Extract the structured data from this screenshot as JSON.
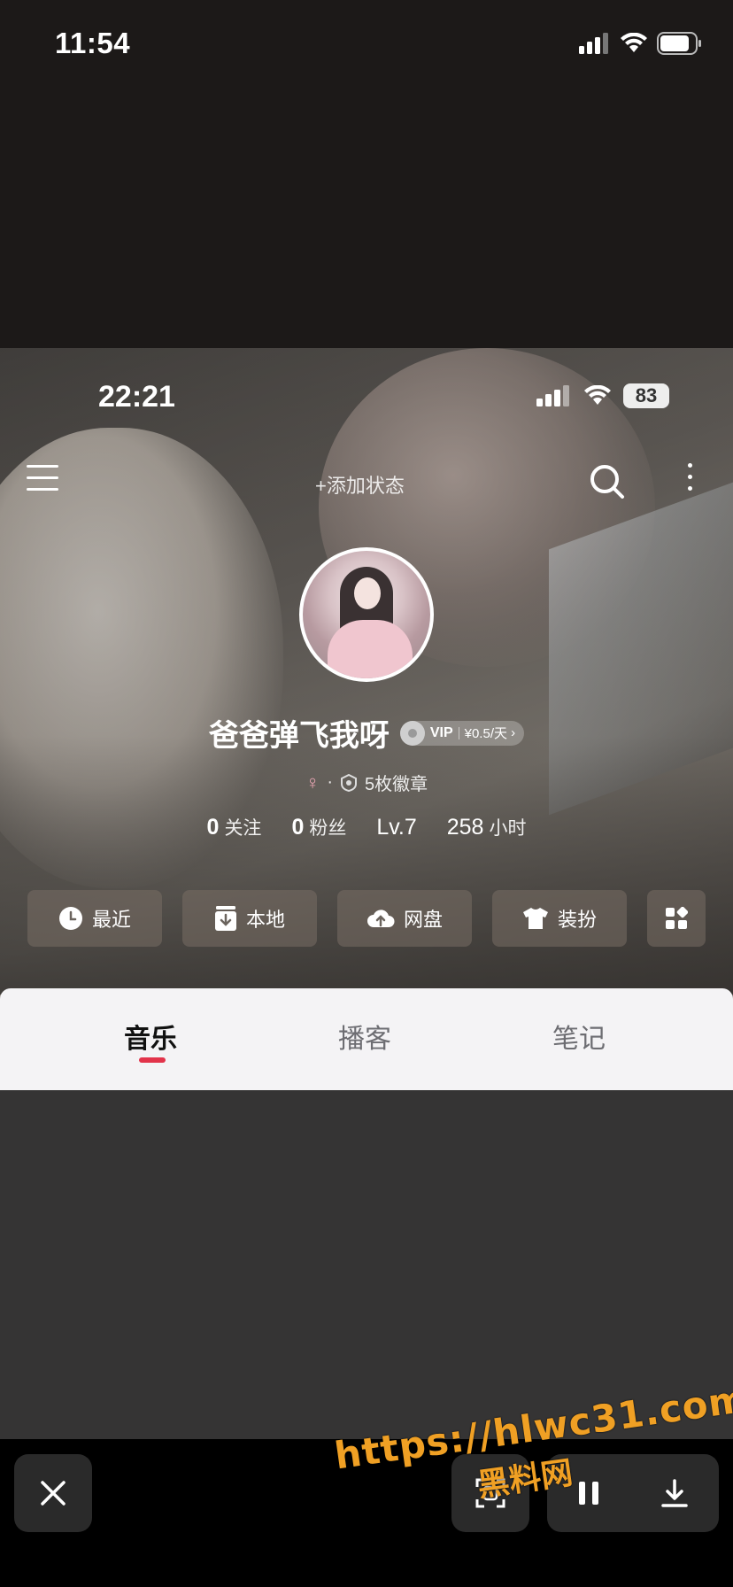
{
  "outer_status": {
    "time": "11:54"
  },
  "inner_status": {
    "time": "22:21",
    "battery": "83"
  },
  "header": {
    "add_status": "+添加状态"
  },
  "profile": {
    "username": "爸爸弹飞我呀",
    "vip_label": "VIP",
    "vip_price": "¥0.5/天",
    "badges": "5枚徽章",
    "meta_separator": "·"
  },
  "stats": [
    {
      "num": "0",
      "label": "关注"
    },
    {
      "num": "0",
      "label": "粉丝"
    },
    {
      "num": "Lv.7",
      "label": ""
    },
    {
      "num": "258",
      "label": "小时"
    }
  ],
  "quick_actions": [
    {
      "label": "最近",
      "icon": "clock-icon"
    },
    {
      "label": "本地",
      "icon": "download-box-icon"
    },
    {
      "label": "网盘",
      "icon": "cloud-upload-icon"
    },
    {
      "label": "装扮",
      "icon": "tshirt-icon"
    }
  ],
  "tabs": [
    {
      "label": "音乐",
      "active": true
    },
    {
      "label": "播客",
      "active": false
    },
    {
      "label": "笔记",
      "active": false
    }
  ],
  "watermark": {
    "url": "https://hlwc31.com",
    "name": "黑料网"
  },
  "colors": {
    "accent": "#e2334a",
    "watermark": "#f0a024"
  }
}
